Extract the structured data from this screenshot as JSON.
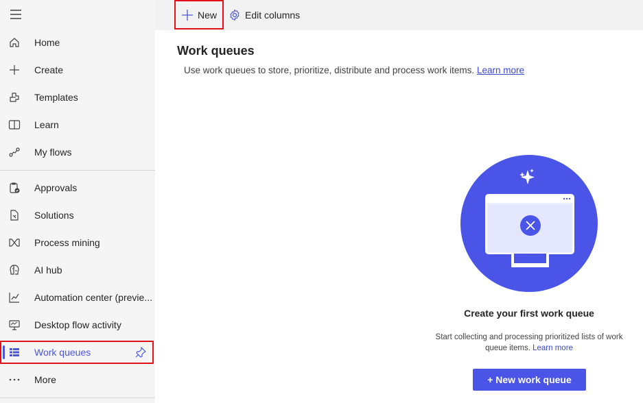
{
  "sidebar": {
    "items": [
      {
        "label": "Home",
        "icon": "home-icon"
      },
      {
        "label": "Create",
        "icon": "plus-icon"
      },
      {
        "label": "Templates",
        "icon": "templates-icon"
      },
      {
        "label": "Learn",
        "icon": "book-icon"
      },
      {
        "label": "My flows",
        "icon": "flows-icon"
      },
      {
        "label": "Approvals",
        "icon": "approvals-icon"
      },
      {
        "label": "Solutions",
        "icon": "solutions-icon"
      },
      {
        "label": "Process mining",
        "icon": "process-mining-icon"
      },
      {
        "label": "AI hub",
        "icon": "ai-hub-icon"
      },
      {
        "label": "Automation center (previe...",
        "icon": "chart-icon"
      },
      {
        "label": "Desktop flow activity",
        "icon": "desktop-icon"
      },
      {
        "label": "Work queues",
        "icon": "work-queues-icon",
        "selected": true
      },
      {
        "label": "More",
        "icon": "more-icon"
      }
    ]
  },
  "toolbar": {
    "new_label": "New",
    "edit_columns_label": "Edit columns"
  },
  "main": {
    "title": "Work queues",
    "description": "Use work queues to store, prioritize, distribute and process work items.",
    "learn_more": "Learn more",
    "empty_title": "Create your first work queue",
    "empty_subtitle": "Start collecting and processing prioritized lists of work queue items.",
    "empty_learn_more": "Learn more",
    "primary_button": "+ New work queue"
  },
  "colors": {
    "accent": "#4a55e8",
    "highlight": "#e0101b",
    "sidebar_bg": "#f5f5f5",
    "toolbar_bg": "#f2f2f2"
  }
}
